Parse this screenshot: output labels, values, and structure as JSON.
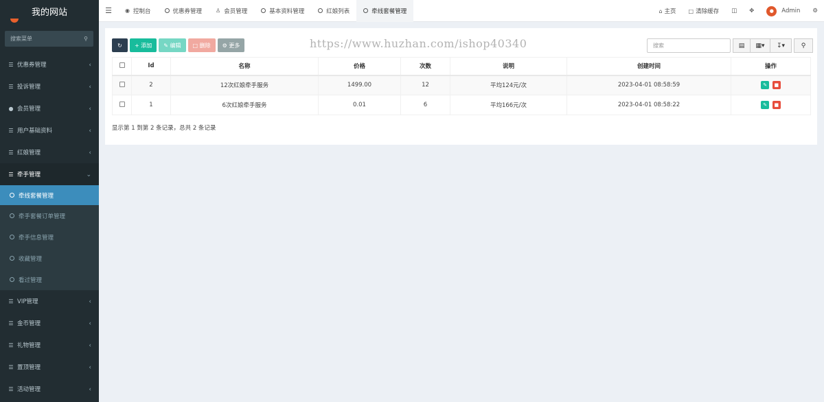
{
  "sidebar": {
    "brand": "我的网站",
    "search_placeholder": "搜索菜单",
    "items": [
      {
        "label": "优惠券管理",
        "caret": "‹"
      },
      {
        "label": "投诉管理",
        "caret": "‹"
      },
      {
        "label": "会员管理",
        "caret": "‹"
      },
      {
        "label": "用户基础资料",
        "caret": "‹"
      },
      {
        "label": "红娘管理",
        "caret": "‹"
      },
      {
        "label": "牵手管理",
        "caret": "⌄"
      }
    ],
    "subitems": [
      {
        "label": "牵线套餐管理"
      },
      {
        "label": "牵手套餐订单管理"
      },
      {
        "label": "牵手信息管理"
      },
      {
        "label": "收藏管理"
      },
      {
        "label": "看过管理"
      }
    ],
    "items_after": [
      {
        "label": "VIP管理",
        "caret": "‹"
      },
      {
        "label": "金币管理",
        "caret": "‹"
      },
      {
        "label": "礼物管理",
        "caret": "‹"
      },
      {
        "label": "置顶管理",
        "caret": "‹"
      },
      {
        "label": "活动管理",
        "caret": "‹"
      }
    ]
  },
  "topbar": {
    "tabs": [
      {
        "label": "控制台"
      },
      {
        "label": "优惠券管理"
      },
      {
        "label": "会员管理"
      },
      {
        "label": "基本资料管理"
      },
      {
        "label": "红娘列表"
      },
      {
        "label": "牵线套餐管理"
      }
    ],
    "home": "主页",
    "clear_cache": "清除缓存",
    "user": "Admin"
  },
  "toolbar": {
    "add": "添加",
    "edit": "编辑",
    "delete": "删除",
    "more": "更多",
    "search_placeholder": "搜索",
    "watermark": "https://www.huzhan.com/ishop40340"
  },
  "table": {
    "headers": [
      "Id",
      "名称",
      "价格",
      "次数",
      "说明",
      "创建时间",
      "操作"
    ],
    "rows": [
      {
        "id": "2",
        "name": "12次红娘牵手服务",
        "price": "1499.00",
        "count": "12",
        "desc": "平均124元/次",
        "created": "2023-04-01 08:58:59"
      },
      {
        "id": "1",
        "name": "6次红娘牵手服务",
        "price": "0.01",
        "count": "6",
        "desc": "平均166元/次",
        "created": "2023-04-01 08:58:22"
      }
    ],
    "footer": "显示第 1 到第 2 条记录，总共 2 条记录"
  },
  "colors": {
    "sidebar_bg": "#222d32",
    "active_blue": "#3c8dbc",
    "add_green": "#18bc9c",
    "delete_red": "#e74c3c"
  }
}
